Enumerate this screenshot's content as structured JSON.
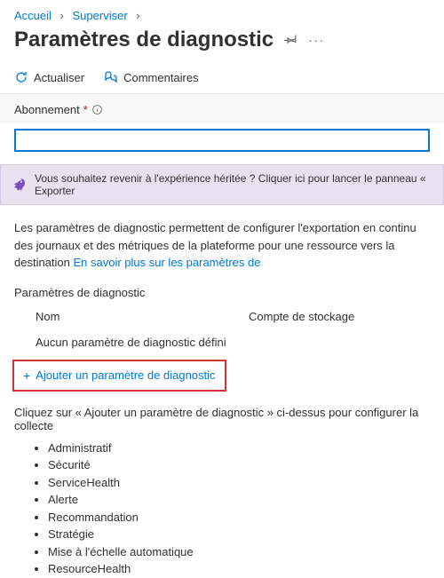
{
  "breadcrumb": {
    "home": "Accueil",
    "monitor": "Superviser"
  },
  "page": {
    "title": "Paramètres de diagnostic"
  },
  "toolbar": {
    "refresh": "Actualiser",
    "feedback": "Commentaires"
  },
  "subscription": {
    "label": "Abonnement"
  },
  "banner": {
    "text": "Vous souhaitez revenir à l'expérience héritée ? Cliquer ici pour lancer le panneau « Exporter"
  },
  "description": {
    "text": "Les paramètres de diagnostic permettent de configurer l'exportation en continu des journaux et des métriques de la plateforme pour une ressource vers la destination ",
    "link": "En savoir plus sur les paramètres de"
  },
  "table": {
    "heading": "Paramètres de diagnostic",
    "col_name": "Nom",
    "col_storage": "Compte de stockage",
    "empty": "Aucun paramètre de diagnostic défini",
    "add": "Ajouter un paramètre de diagnostic"
  },
  "instruction": {
    "text": "Cliquez sur « Ajouter un paramètre de diagnostic » ci-dessus pour configurer la collecte"
  },
  "categories": [
    "Administratif",
    "Sécurité",
    "ServiceHealth",
    "Alerte",
    "Recommandation",
    "Stratégie",
    "Mise à l'échelle automatique",
    "ResourceHealth"
  ]
}
